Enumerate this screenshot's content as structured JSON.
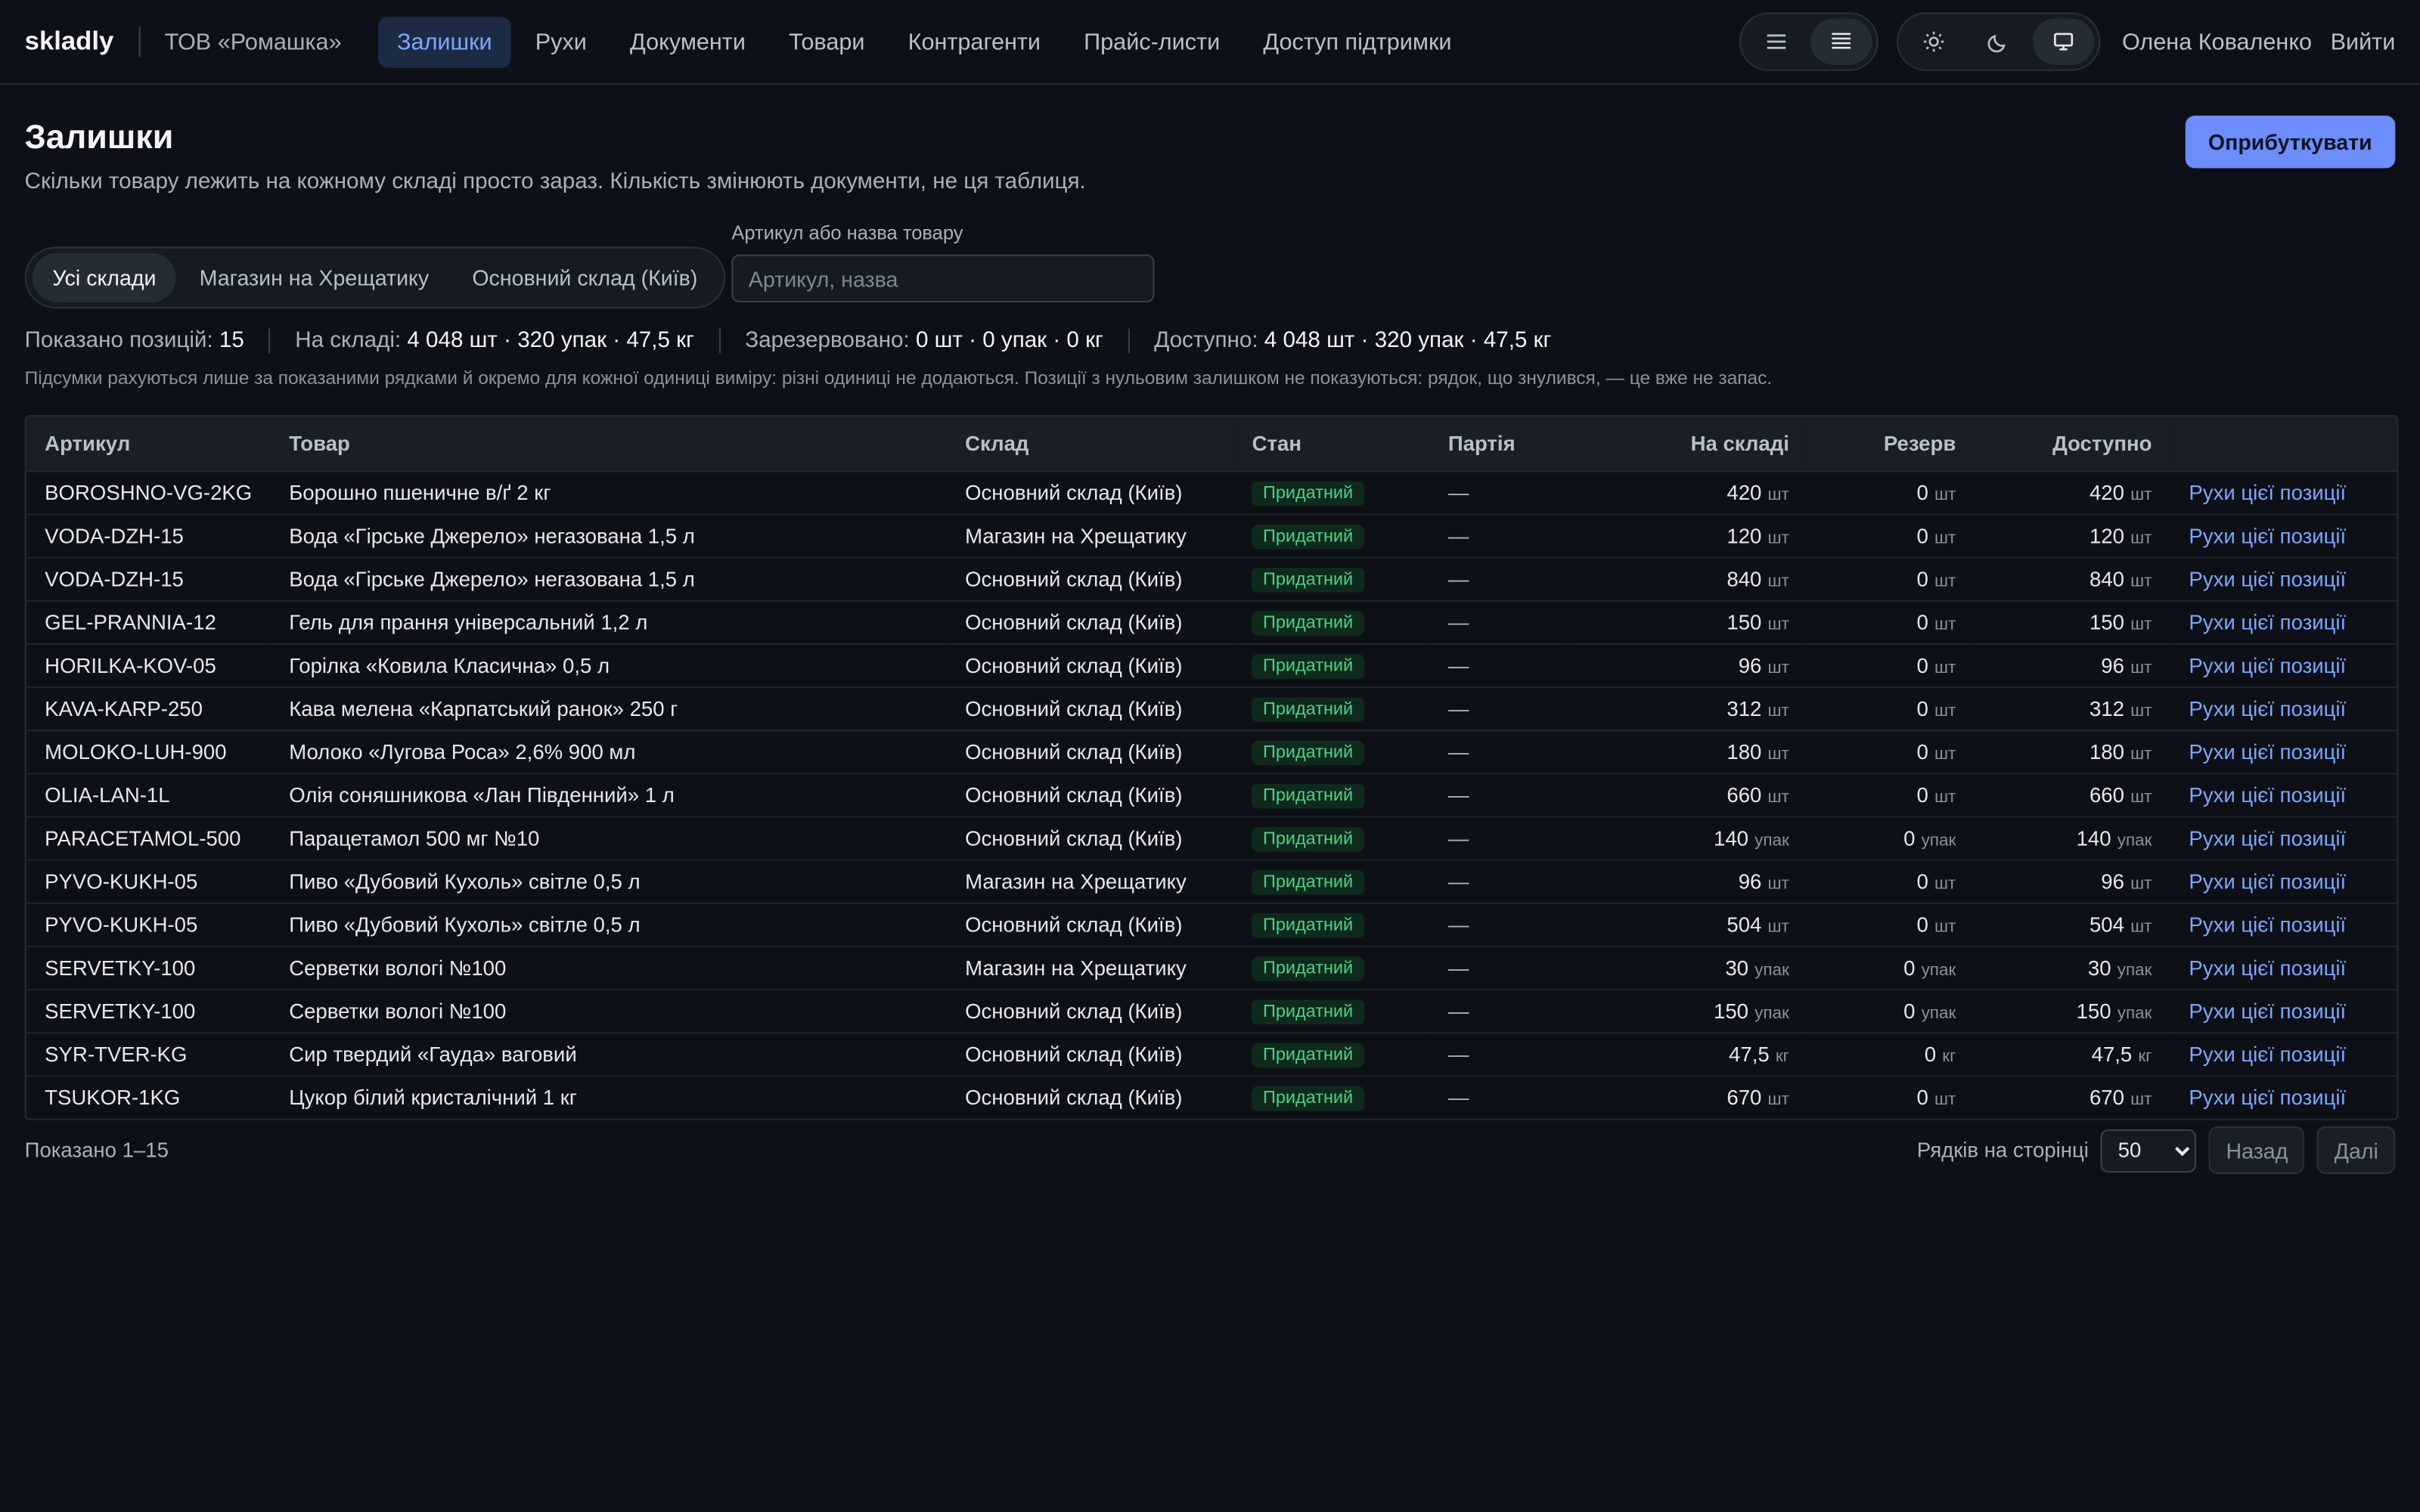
{
  "app": {
    "brand": "skladly",
    "org": "ТОВ «Ромашка»",
    "nav": [
      "Залишки",
      "Рухи",
      "Документи",
      "Товари",
      "Контрагенти",
      "Прайс-листи",
      "Доступ підтримки"
    ],
    "user": "Олена Коваленко",
    "logout": "Вийти"
  },
  "header": {
    "title": "Залишки",
    "subtitle": "Скільки товару лежить на кожному складі просто зараз. Кількість змінюють документи, не ця таблиця.",
    "action": "Оприбуткувати"
  },
  "filters": {
    "tabs": [
      "Усі склади",
      "Магазин на Хрещатику",
      "Основний склад (Київ)"
    ],
    "search_label": "Артикул або назва товару",
    "search_placeholder": "Артикул, назва",
    "search_value": ""
  },
  "summary": {
    "shown_label": "Показано позицій:",
    "shown_value": "15",
    "stock_label": "На складі:",
    "stock_value": "4 048 шт · 320 упак · 47,5 кг",
    "reserved_label": "Зарезервовано:",
    "reserved_value": "0 шт · 0 упак · 0 кг",
    "available_label": "Доступно:",
    "available_value": "4 048 шт · 320 упак · 47,5 кг",
    "note": "Підсумки рахуються лише за показаними рядками й окремо для кожної одиниці виміру: різні одиниці не додаються. Позиції з нульовим залишком не показуються: рядок, що знулився, — це вже не запас."
  },
  "table": {
    "columns": [
      "Артикул",
      "Товар",
      "Склад",
      "Стан",
      "Партія",
      "На складі",
      "Резерв",
      "Доступно",
      ""
    ],
    "rows": [
      {
        "sku": "BOROSHNO-VG-2KG",
        "name": "Борошно пшеничне в/ґ 2 кг",
        "wh": "Основний склад (Київ)",
        "state": "Придатний",
        "batch": "—",
        "stock": "420",
        "su": "шт",
        "res": "0",
        "ru": "шт",
        "avail": "420",
        "au": "шт",
        "link": "Рухи цієї позиції"
      },
      {
        "sku": "VODA-DZH-15",
        "name": "Вода «Гірське Джерело» негазована 1,5 л",
        "wh": "Магазин на Хрещатику",
        "state": "Придатний",
        "batch": "—",
        "stock": "120",
        "su": "шт",
        "res": "0",
        "ru": "шт",
        "avail": "120",
        "au": "шт",
        "link": "Рухи цієї позиції"
      },
      {
        "sku": "VODA-DZH-15",
        "name": "Вода «Гірське Джерело» негазована 1,5 л",
        "wh": "Основний склад (Київ)",
        "state": "Придатний",
        "batch": "—",
        "stock": "840",
        "su": "шт",
        "res": "0",
        "ru": "шт",
        "avail": "840",
        "au": "шт",
        "link": "Рухи цієї позиції"
      },
      {
        "sku": "GEL-PRANNIA-12",
        "name": "Гель для прання універсальний 1,2 л",
        "wh": "Основний склад (Київ)",
        "state": "Придатний",
        "batch": "—",
        "stock": "150",
        "su": "шт",
        "res": "0",
        "ru": "шт",
        "avail": "150",
        "au": "шт",
        "link": "Рухи цієї позиції"
      },
      {
        "sku": "HORILKA-KOV-05",
        "name": "Горілка «Ковила Класична» 0,5 л",
        "wh": "Основний склад (Київ)",
        "state": "Придатний",
        "batch": "—",
        "stock": "96",
        "su": "шт",
        "res": "0",
        "ru": "шт",
        "avail": "96",
        "au": "шт",
        "link": "Рухи цієї позиції"
      },
      {
        "sku": "KAVA-KARP-250",
        "name": "Кава мелена «Карпатський ранок» 250 г",
        "wh": "Основний склад (Київ)",
        "state": "Придатний",
        "batch": "—",
        "stock": "312",
        "su": "шт",
        "res": "0",
        "ru": "шт",
        "avail": "312",
        "au": "шт",
        "link": "Рухи цієї позиції"
      },
      {
        "sku": "MOLOKO-LUH-900",
        "name": "Молоко «Лугова Роса» 2,6% 900 мл",
        "wh": "Основний склад (Київ)",
        "state": "Придатний",
        "batch": "—",
        "stock": "180",
        "su": "шт",
        "res": "0",
        "ru": "шт",
        "avail": "180",
        "au": "шт",
        "link": "Рухи цієї позиції"
      },
      {
        "sku": "OLIA-LAN-1L",
        "name": "Олія соняшникова «Лан Південний» 1 л",
        "wh": "Основний склад (Київ)",
        "state": "Придатний",
        "batch": "—",
        "stock": "660",
        "su": "шт",
        "res": "0",
        "ru": "шт",
        "avail": "660",
        "au": "шт",
        "link": "Рухи цієї позиції"
      },
      {
        "sku": "PARACETAMOL-500",
        "name": "Парацетамол 500 мг №10",
        "wh": "Основний склад (Київ)",
        "state": "Придатний",
        "batch": "—",
        "stock": "140",
        "su": "упак",
        "res": "0",
        "ru": "упак",
        "avail": "140",
        "au": "упак",
        "link": "Рухи цієї позиції"
      },
      {
        "sku": "PYVO-KUKH-05",
        "name": "Пиво «Дубовий Кухоль» світле 0,5 л",
        "wh": "Магазин на Хрещатику",
        "state": "Придатний",
        "batch": "—",
        "stock": "96",
        "su": "шт",
        "res": "0",
        "ru": "шт",
        "avail": "96",
        "au": "шт",
        "link": "Рухи цієї позиції"
      },
      {
        "sku": "PYVO-KUKH-05",
        "name": "Пиво «Дубовий Кухоль» світле 0,5 л",
        "wh": "Основний склад (Київ)",
        "state": "Придатний",
        "batch": "—",
        "stock": "504",
        "su": "шт",
        "res": "0",
        "ru": "шт",
        "avail": "504",
        "au": "шт",
        "link": "Рухи цієї позиції"
      },
      {
        "sku": "SERVETKY-100",
        "name": "Серветки вологі №100",
        "wh": "Магазин на Хрещатику",
        "state": "Придатний",
        "batch": "—",
        "stock": "30",
        "su": "упак",
        "res": "0",
        "ru": "упак",
        "avail": "30",
        "au": "упак",
        "link": "Рухи цієї позиції"
      },
      {
        "sku": "SERVETKY-100",
        "name": "Серветки вологі №100",
        "wh": "Основний склад (Київ)",
        "state": "Придатний",
        "batch": "—",
        "stock": "150",
        "su": "упак",
        "res": "0",
        "ru": "упак",
        "avail": "150",
        "au": "упак",
        "link": "Рухи цієї позиції"
      },
      {
        "sku": "SYR-TVER-KG",
        "name": "Сир твердий «Гауда» ваговий",
        "wh": "Основний склад (Київ)",
        "state": "Придатний",
        "batch": "—",
        "stock": "47,5",
        "su": "кг",
        "res": "0",
        "ru": "кг",
        "avail": "47,5",
        "au": "кг",
        "link": "Рухи цієї позиції"
      },
      {
        "sku": "TSUKOR-1KG",
        "name": "Цукор білий кристалічний 1 кг",
        "wh": "Основний склад (Київ)",
        "state": "Придатний",
        "batch": "—",
        "stock": "670",
        "su": "шт",
        "res": "0",
        "ru": "шт",
        "avail": "670",
        "au": "шт",
        "link": "Рухи цієї позиції"
      }
    ]
  },
  "footer": {
    "shown": "Показано 1–15",
    "rows_label": "Рядків на сторінці",
    "rows_value": "50",
    "prev": "Назад",
    "next": "Далі"
  },
  "icons": {
    "density": [
      "list-compact-icon",
      "list-dense-icon"
    ],
    "theme": [
      "sun-icon",
      "moon-icon",
      "monitor-icon"
    ]
  }
}
